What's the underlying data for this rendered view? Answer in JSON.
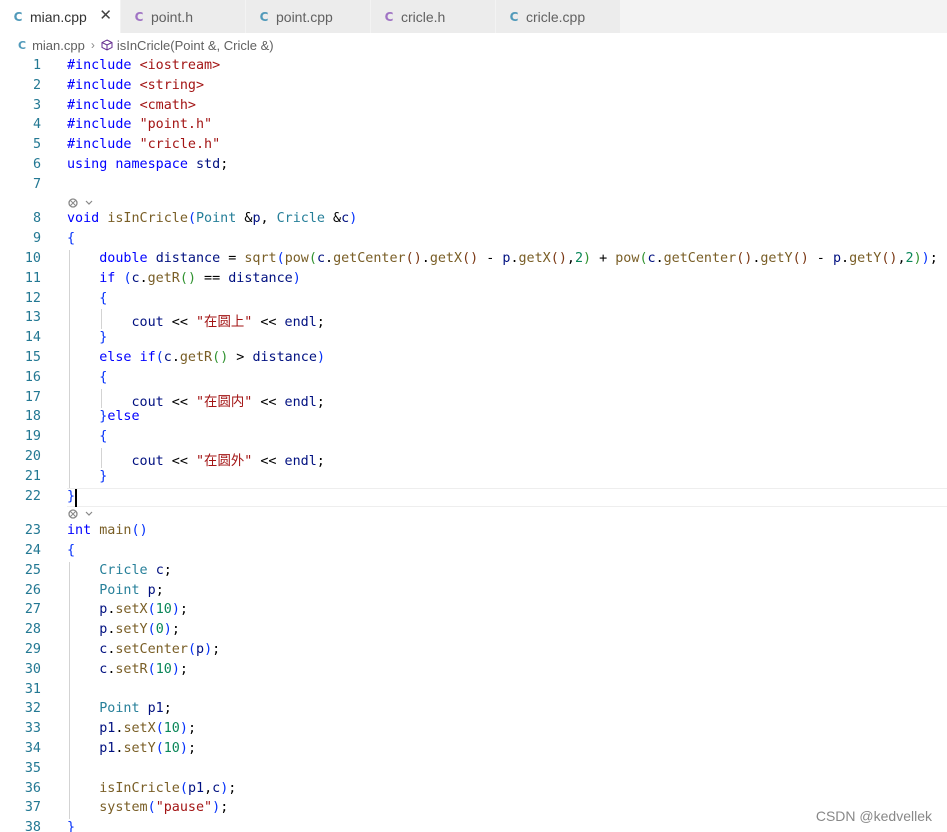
{
  "tabs": [
    {
      "icon": "C",
      "icon_kind": "cpp",
      "label": "mian.cpp",
      "active": true
    },
    {
      "icon": "C",
      "icon_kind": "h",
      "label": "point.h",
      "active": false
    },
    {
      "icon": "C",
      "icon_kind": "cpp",
      "label": "point.cpp",
      "active": false
    },
    {
      "icon": "C",
      "icon_kind": "h",
      "label": "cricle.h",
      "active": false
    },
    {
      "icon": "C",
      "icon_kind": "cpp",
      "label": "cricle.cpp",
      "active": false
    }
  ],
  "breadcrumb": {
    "file": "mian.cpp",
    "separator": "›",
    "symbol": "isInCricle(Point &, Cricle &)"
  },
  "code": {
    "lines": [
      {
        "n": "1",
        "text": "#include <iostream>"
      },
      {
        "n": "2",
        "text": "#include <string>"
      },
      {
        "n": "3",
        "text": "#include <cmath>"
      },
      {
        "n": "4",
        "text": "#include \"point.h\""
      },
      {
        "n": "5",
        "text": "#include \"cricle.h\""
      },
      {
        "n": "6",
        "text": "using namespace std;"
      },
      {
        "n": "7",
        "text": ""
      },
      {
        "n": "8",
        "text": "void isInCricle(Point &p, Cricle &c)"
      },
      {
        "n": "9",
        "text": "{"
      },
      {
        "n": "10",
        "text": "    double distance = sqrt(pow(c.getCenter().getX() - p.getX(),2) + pow(c.getCenter().getY() - p.getY(),2));"
      },
      {
        "n": "11",
        "text": "    if (c.getR() == distance)"
      },
      {
        "n": "12",
        "text": "    {"
      },
      {
        "n": "13",
        "text": "        cout << \"在圆上\" << endl;"
      },
      {
        "n": "14",
        "text": "    }"
      },
      {
        "n": "15",
        "text": "    else if(c.getR() > distance)"
      },
      {
        "n": "16",
        "text": "    {"
      },
      {
        "n": "17",
        "text": "        cout << \"在圆内\" << endl;"
      },
      {
        "n": "18",
        "text": "    }else"
      },
      {
        "n": "19",
        "text": "    {"
      },
      {
        "n": "20",
        "text": "        cout << \"在圆外\" << endl;"
      },
      {
        "n": "21",
        "text": "    }"
      },
      {
        "n": "22",
        "text": "}"
      },
      {
        "n": "23",
        "text": "int main()"
      },
      {
        "n": "24",
        "text": "{"
      },
      {
        "n": "25",
        "text": "    Cricle c;"
      },
      {
        "n": "26",
        "text": "    Point p;"
      },
      {
        "n": "27",
        "text": "    p.setX(10);"
      },
      {
        "n": "28",
        "text": "    p.setY(0);"
      },
      {
        "n": "29",
        "text": "    c.setCenter(p);"
      },
      {
        "n": "30",
        "text": "    c.setR(10);"
      },
      {
        "n": "31",
        "text": ""
      },
      {
        "n": "32",
        "text": "    Point p1;"
      },
      {
        "n": "33",
        "text": "    p1.setX(10);"
      },
      {
        "n": "34",
        "text": "    p1.setY(10);"
      },
      {
        "n": "35",
        "text": ""
      },
      {
        "n": "36",
        "text": "    isInCricle(p1,c);"
      },
      {
        "n": "37",
        "text": "    system(\"pause\");"
      },
      {
        "n": "38",
        "text": "}"
      }
    ],
    "codelens_after": [
      "7",
      "22"
    ]
  },
  "colors": {
    "keyword": "#0000ff",
    "string": "#a31515",
    "type": "#267f99",
    "function": "#795e26",
    "variable": "#001080",
    "number": "#098658",
    "line_number": "#237893"
  },
  "watermark": "CSDN @kedvellek"
}
